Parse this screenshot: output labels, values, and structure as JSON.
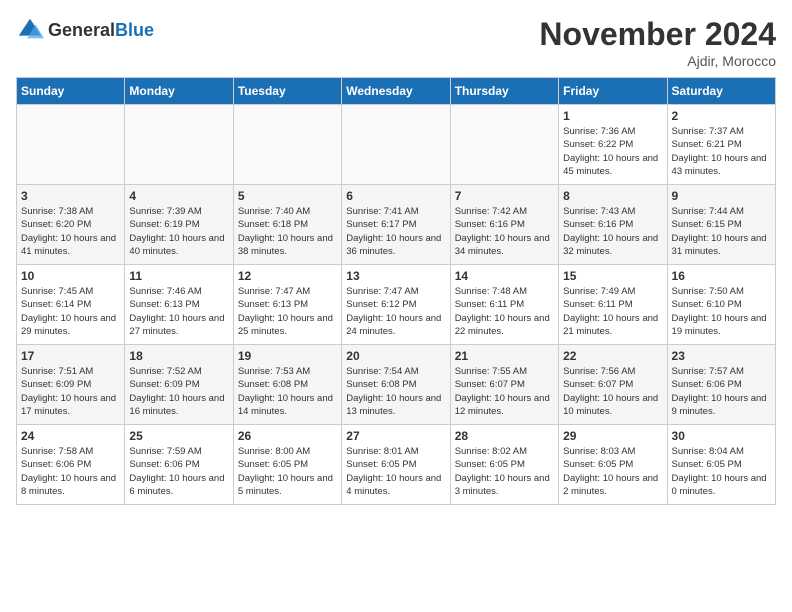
{
  "header": {
    "logo_general": "General",
    "logo_blue": "Blue",
    "month_year": "November 2024",
    "location": "Ajdir, Morocco"
  },
  "days_of_week": [
    "Sunday",
    "Monday",
    "Tuesday",
    "Wednesday",
    "Thursday",
    "Friday",
    "Saturday"
  ],
  "weeks": [
    [
      {
        "day": "",
        "empty": true
      },
      {
        "day": "",
        "empty": true
      },
      {
        "day": "",
        "empty": true
      },
      {
        "day": "",
        "empty": true
      },
      {
        "day": "",
        "empty": true
      },
      {
        "day": "1",
        "sunrise": "7:36 AM",
        "sunset": "6:22 PM",
        "daylight": "10 hours and 45 minutes."
      },
      {
        "day": "2",
        "sunrise": "7:37 AM",
        "sunset": "6:21 PM",
        "daylight": "10 hours and 43 minutes."
      }
    ],
    [
      {
        "day": "3",
        "sunrise": "7:38 AM",
        "sunset": "6:20 PM",
        "daylight": "10 hours and 41 minutes."
      },
      {
        "day": "4",
        "sunrise": "7:39 AM",
        "sunset": "6:19 PM",
        "daylight": "10 hours and 40 minutes."
      },
      {
        "day": "5",
        "sunrise": "7:40 AM",
        "sunset": "6:18 PM",
        "daylight": "10 hours and 38 minutes."
      },
      {
        "day": "6",
        "sunrise": "7:41 AM",
        "sunset": "6:17 PM",
        "daylight": "10 hours and 36 minutes."
      },
      {
        "day": "7",
        "sunrise": "7:42 AM",
        "sunset": "6:16 PM",
        "daylight": "10 hours and 34 minutes."
      },
      {
        "day": "8",
        "sunrise": "7:43 AM",
        "sunset": "6:16 PM",
        "daylight": "10 hours and 32 minutes."
      },
      {
        "day": "9",
        "sunrise": "7:44 AM",
        "sunset": "6:15 PM",
        "daylight": "10 hours and 31 minutes."
      }
    ],
    [
      {
        "day": "10",
        "sunrise": "7:45 AM",
        "sunset": "6:14 PM",
        "daylight": "10 hours and 29 minutes."
      },
      {
        "day": "11",
        "sunrise": "7:46 AM",
        "sunset": "6:13 PM",
        "daylight": "10 hours and 27 minutes."
      },
      {
        "day": "12",
        "sunrise": "7:47 AM",
        "sunset": "6:13 PM",
        "daylight": "10 hours and 25 minutes."
      },
      {
        "day": "13",
        "sunrise": "7:47 AM",
        "sunset": "6:12 PM",
        "daylight": "10 hours and 24 minutes."
      },
      {
        "day": "14",
        "sunrise": "7:48 AM",
        "sunset": "6:11 PM",
        "daylight": "10 hours and 22 minutes."
      },
      {
        "day": "15",
        "sunrise": "7:49 AM",
        "sunset": "6:11 PM",
        "daylight": "10 hours and 21 minutes."
      },
      {
        "day": "16",
        "sunrise": "7:50 AM",
        "sunset": "6:10 PM",
        "daylight": "10 hours and 19 minutes."
      }
    ],
    [
      {
        "day": "17",
        "sunrise": "7:51 AM",
        "sunset": "6:09 PM",
        "daylight": "10 hours and 17 minutes."
      },
      {
        "day": "18",
        "sunrise": "7:52 AM",
        "sunset": "6:09 PM",
        "daylight": "10 hours and 16 minutes."
      },
      {
        "day": "19",
        "sunrise": "7:53 AM",
        "sunset": "6:08 PM",
        "daylight": "10 hours and 14 minutes."
      },
      {
        "day": "20",
        "sunrise": "7:54 AM",
        "sunset": "6:08 PM",
        "daylight": "10 hours and 13 minutes."
      },
      {
        "day": "21",
        "sunrise": "7:55 AM",
        "sunset": "6:07 PM",
        "daylight": "10 hours and 12 minutes."
      },
      {
        "day": "22",
        "sunrise": "7:56 AM",
        "sunset": "6:07 PM",
        "daylight": "10 hours and 10 minutes."
      },
      {
        "day": "23",
        "sunrise": "7:57 AM",
        "sunset": "6:06 PM",
        "daylight": "10 hours and 9 minutes."
      }
    ],
    [
      {
        "day": "24",
        "sunrise": "7:58 AM",
        "sunset": "6:06 PM",
        "daylight": "10 hours and 8 minutes."
      },
      {
        "day": "25",
        "sunrise": "7:59 AM",
        "sunset": "6:06 PM",
        "daylight": "10 hours and 6 minutes."
      },
      {
        "day": "26",
        "sunrise": "8:00 AM",
        "sunset": "6:05 PM",
        "daylight": "10 hours and 5 minutes."
      },
      {
        "day": "27",
        "sunrise": "8:01 AM",
        "sunset": "6:05 PM",
        "daylight": "10 hours and 4 minutes."
      },
      {
        "day": "28",
        "sunrise": "8:02 AM",
        "sunset": "6:05 PM",
        "daylight": "10 hours and 3 minutes."
      },
      {
        "day": "29",
        "sunrise": "8:03 AM",
        "sunset": "6:05 PM",
        "daylight": "10 hours and 2 minutes."
      },
      {
        "day": "30",
        "sunrise": "8:04 AM",
        "sunset": "6:05 PM",
        "daylight": "10 hours and 0 minutes."
      }
    ]
  ],
  "labels": {
    "sunrise": "Sunrise:",
    "sunset": "Sunset:",
    "daylight": "Daylight:"
  }
}
